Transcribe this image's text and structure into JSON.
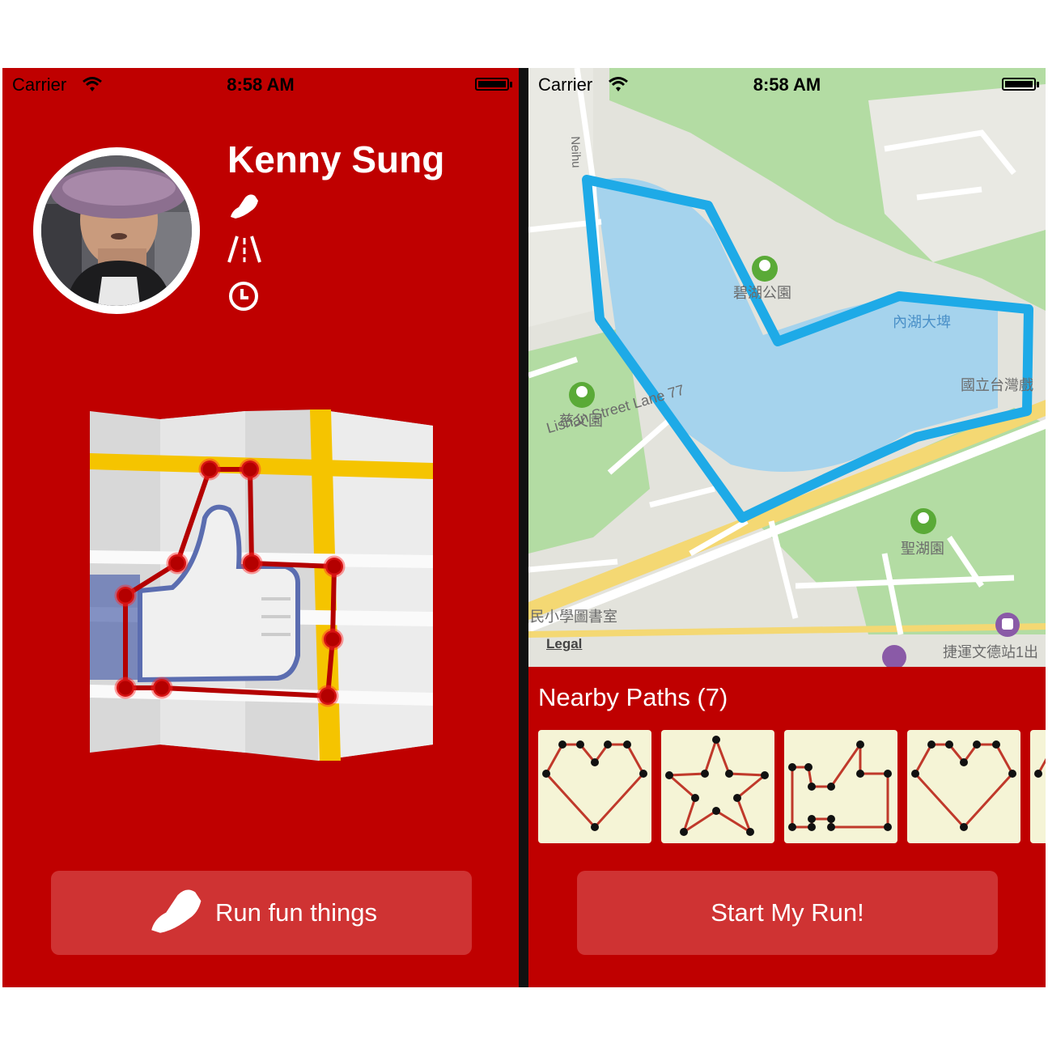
{
  "left_screen": {
    "status_bar": {
      "carrier": "Carrier",
      "time": "8:58 AM"
    },
    "profile": {
      "name": "Kenny Sung"
    },
    "icons": [
      "shoe-icon",
      "road-icon",
      "clock-icon"
    ],
    "run_button_label": "Run fun things"
  },
  "right_screen": {
    "status_bar": {
      "carrier": "Carrier",
      "time": "8:58 AM"
    },
    "map": {
      "legal": "Legal",
      "labels": {
        "park1": "碧湖公園",
        "dam": "內湖大埤",
        "univ": "國立台灣戲",
        "park2": "慈父園",
        "street": "Lishan Street Lane 77",
        "park3": "聖湖園",
        "library": "民小學圖書室",
        "metro": "捷運文德站1出",
        "road": "Neihu"
      },
      "route_color": "#1eaae7"
    },
    "nearby_paths_title": "Nearby Paths (7)",
    "path_shapes": [
      "heart",
      "star",
      "thumbs-up",
      "heart"
    ],
    "start_button_label": "Start My Run!"
  },
  "colors": {
    "brand": "#bf0000",
    "button": "#cf3333",
    "card": "#f5f4d6"
  }
}
